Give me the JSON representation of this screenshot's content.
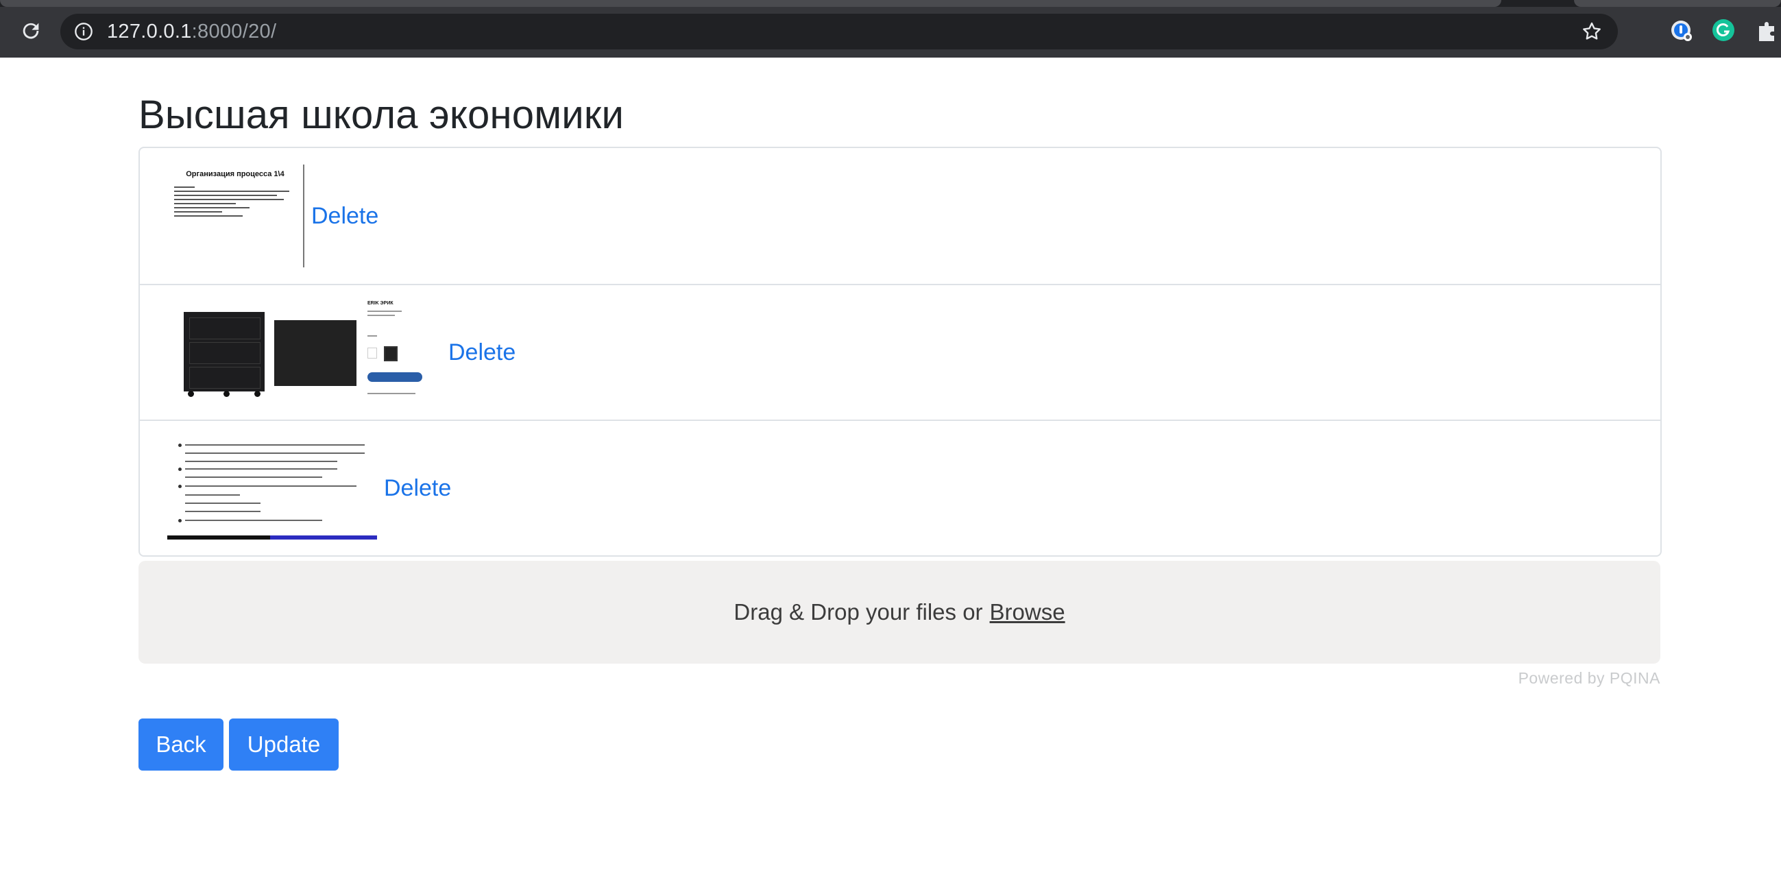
{
  "browser": {
    "url_host": "127.0.0.1",
    "url_path": ":8000/20/"
  },
  "page": {
    "title": "Высшая школа экономики"
  },
  "files": [
    {
      "thumbnail_title": "Организация процесса 1\\4",
      "delete_label": "Delete"
    },
    {
      "thumbnail_title": "ERIK ЭРИК",
      "delete_label": "Delete"
    },
    {
      "thumbnail_title": "",
      "delete_label": "Delete"
    }
  ],
  "dropzone": {
    "text": "Drag & Drop your files or",
    "browse_label": "Browse",
    "powered_by": "Powered by PQINA"
  },
  "actions": {
    "back_label": "Back",
    "update_label": "Update"
  },
  "colors": {
    "link": "#1a73e8",
    "button": "#2f80f5",
    "dropzone_bg": "#f1f0ef"
  }
}
